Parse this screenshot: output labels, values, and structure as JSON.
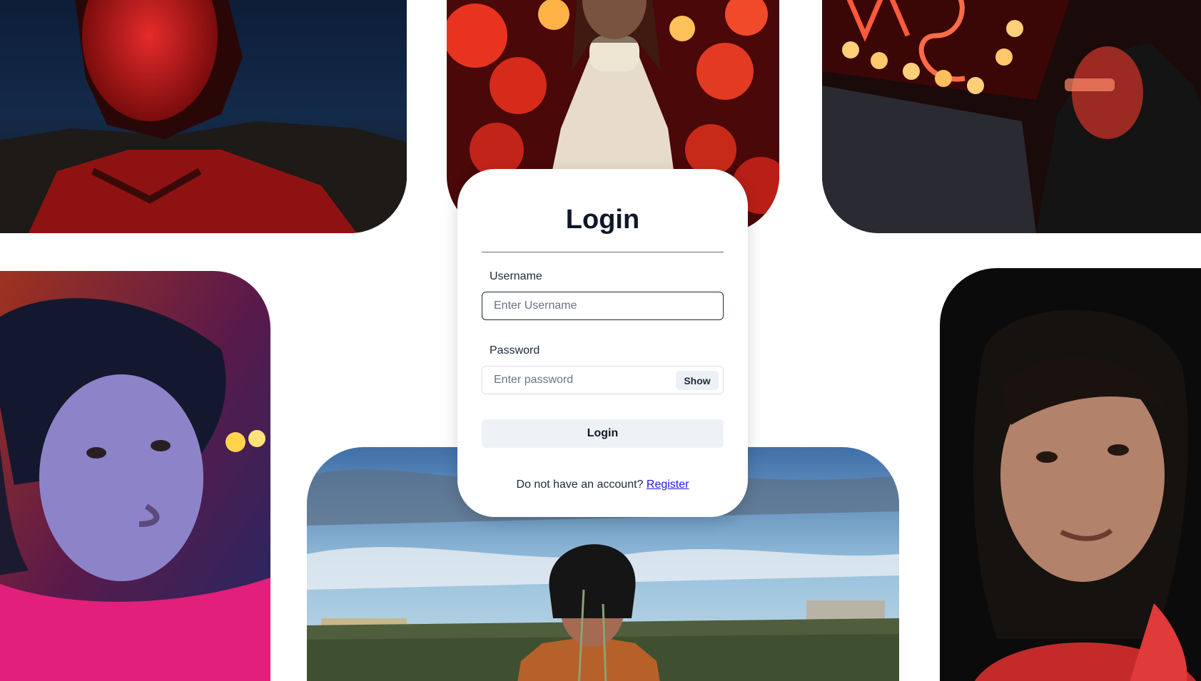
{
  "login_card": {
    "title": "Login",
    "username": {
      "label": "Username",
      "placeholder": "Enter Username",
      "value": ""
    },
    "password": {
      "label": "Password",
      "placeholder": "Enter password",
      "value": "",
      "toggle_label": "Show"
    },
    "submit_label": "Login",
    "register_prompt": "Do not have an account?",
    "register_link": "Register"
  },
  "colors": {
    "title": "#0f172a",
    "link": "#1d18e6",
    "button_bg": "#eef2f6",
    "card_bg": "#ffffff"
  },
  "background_photos": [
    "portrait-red-light-night",
    "portrait-red-lanterns-sweater",
    "portrait-neon-sign-hoodie",
    "portrait-curly-hair-pink-sweater",
    "portrait-headscarf-field-sky",
    "portrait-dark-background-woman"
  ]
}
